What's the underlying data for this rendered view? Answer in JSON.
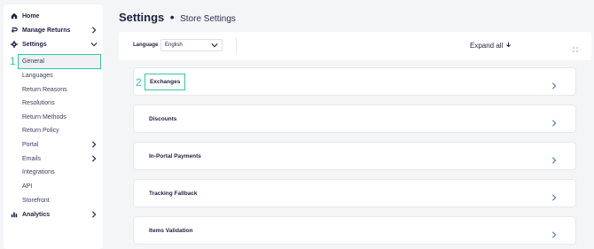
{
  "sidebar": {
    "items": [
      {
        "label": "Home",
        "icon": "home-icon",
        "chevron": false
      },
      {
        "label": "Manage Returns",
        "icon": "return-icon",
        "chevron": true
      },
      {
        "label": "Settings",
        "icon": "gear-icon",
        "chevron": true,
        "expanded": true
      },
      {
        "label": "Analytics",
        "icon": "bar-chart-icon",
        "chevron": true
      }
    ],
    "settings_children": [
      {
        "label": "General",
        "active": true
      },
      {
        "label": "Languages"
      },
      {
        "label": "Return Reasons"
      },
      {
        "label": "Resolutions"
      },
      {
        "label": "Return Methods"
      },
      {
        "label": "Return Policy"
      },
      {
        "label": "Portal",
        "chevron": true
      },
      {
        "label": "Emails",
        "chevron": true
      },
      {
        "label": "Integrations"
      },
      {
        "label": "API"
      },
      {
        "label": "Storefront"
      }
    ]
  },
  "annotations": {
    "step1": "1",
    "step2": "2",
    "accent": "#2fc8a3"
  },
  "header": {
    "title": "Settings",
    "separator": "•",
    "subtitle": "Store Settings"
  },
  "toolbar": {
    "language_label": "Language",
    "language_value": "English",
    "expand_label": "Expand all"
  },
  "sections": [
    {
      "title": "Exchanges",
      "highlighted": true
    },
    {
      "title": "Discounts"
    },
    {
      "title": "In-Portal Payments"
    },
    {
      "title": "Tracking Fallback"
    },
    {
      "title": "Items Validation"
    }
  ]
}
